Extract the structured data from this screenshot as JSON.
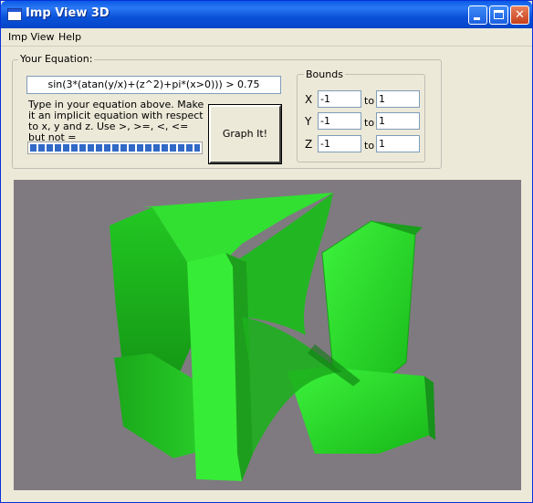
{
  "window": {
    "title": "Imp View 3D"
  },
  "menu": {
    "items": [
      {
        "label": "Imp View"
      },
      {
        "label": "Help"
      }
    ]
  },
  "equation_group": {
    "label": "Your Equation:",
    "equation_value": "sin(3*(atan(y/x)+(z^2)+pi*(x>0))) > 0.75",
    "help_text": "Type in your equation above. Make it an implicit equation with respect to x, y and z. Use >, >=, <, <= but not =",
    "progress_percent": 100,
    "graph_button_label": "Graph It!"
  },
  "bounds": {
    "label": "Bounds",
    "to_label": "to",
    "axes": [
      {
        "axis": "X",
        "min": "-1",
        "max": "1"
      },
      {
        "axis": "Y",
        "min": "-1",
        "max": "1"
      },
      {
        "axis": "Z",
        "min": "-1",
        "max": "1"
      }
    ]
  },
  "colors": {
    "viewport_background": "#7f7a80",
    "surface_color": "#2ee82e",
    "title_bar": "#0a52d8",
    "progress_fill": "#3169c6"
  },
  "icons": {
    "app": "window-icon",
    "minimize": "minimize-icon",
    "maximize": "maximize-icon",
    "close": "close-icon"
  }
}
